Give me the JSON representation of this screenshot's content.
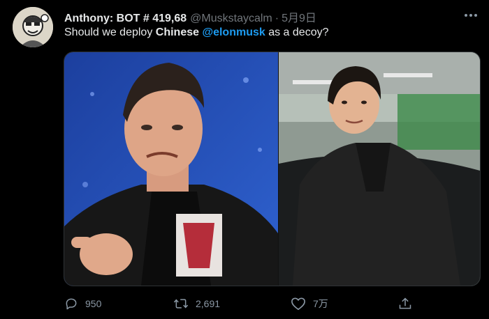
{
  "tweet": {
    "author": {
      "display_name": "Anthony: BOT # 419,68",
      "handle": "@Muskstaycalm",
      "separator": "·",
      "date": "5月9日",
      "avatar_icon": "cartoon-avatar"
    },
    "text": {
      "part1": "Should we deploy ",
      "bold": "Chinese",
      "space": " ",
      "mention": "@elonmusk",
      "part2": " as a decoy?"
    },
    "media": {
      "left_image": "photo-man-leather-jacket-thumbs",
      "right_image": "photo-lookalike-black-coat-garage"
    },
    "actions": {
      "reply": {
        "icon": "reply-icon",
        "count": "950"
      },
      "retweet": {
        "icon": "retweet-icon",
        "count": "2,691"
      },
      "like": {
        "icon": "heart-icon",
        "count": "7万"
      },
      "share": {
        "icon": "share-icon",
        "count": ""
      }
    },
    "colors": {
      "background": "#000000",
      "text": "#e7e9ea",
      "muted": "#71767b",
      "link": "#1d9bf0"
    }
  }
}
